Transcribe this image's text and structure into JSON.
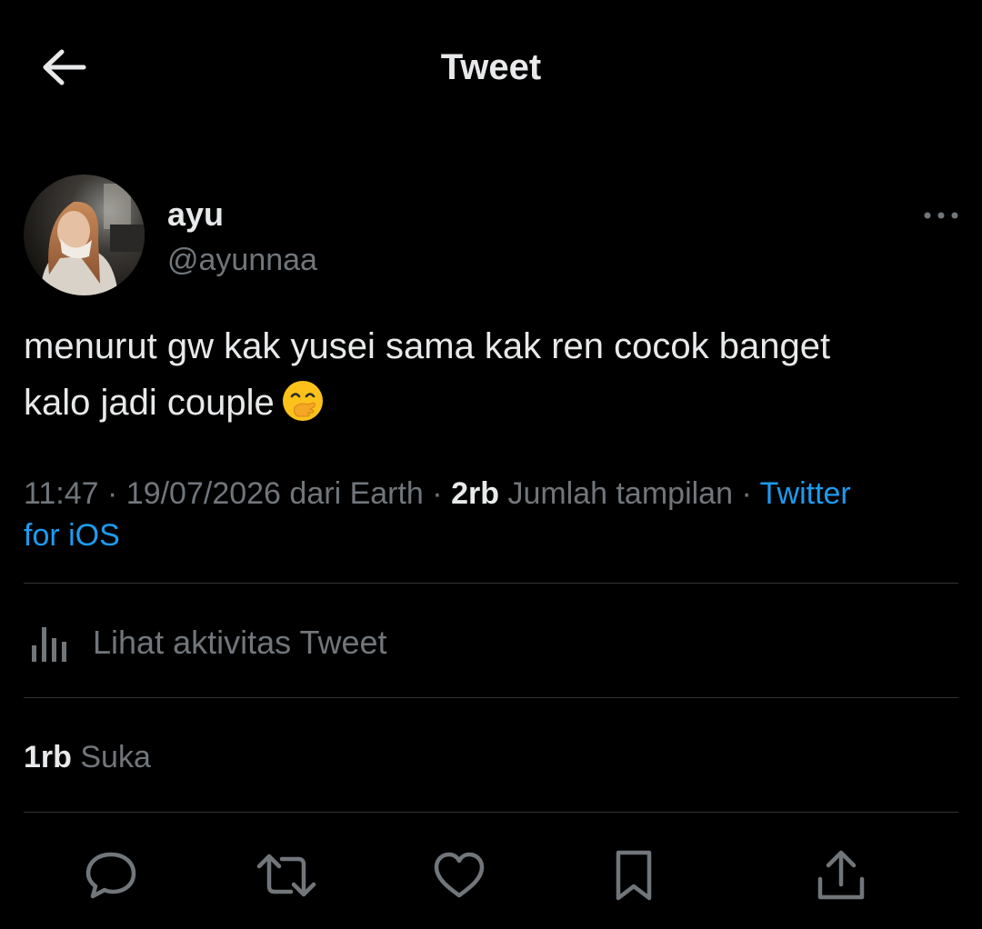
{
  "header": {
    "title": "Tweet",
    "back_icon": "arrow-left-icon"
  },
  "author": {
    "display_name": "ayu",
    "handle": "@ayunnaa",
    "more_icon": "more-horizontal-icon"
  },
  "tweet": {
    "text_line1": "menurut gw kak yusei sama kak ren cocok banget",
    "text_line2": "kalo jadi couple",
    "emoji_icon": "hand-over-mouth-emoji-icon"
  },
  "meta": {
    "time": "11:47",
    "separator": "·",
    "date": "19/07/2026",
    "location": "dari Earth",
    "views_count": "2rb",
    "views_label": "Jumlah tampilan",
    "client_part1": "Twitter",
    "client_part2": "for iOS"
  },
  "activity": {
    "label": "Lihat aktivitas Tweet",
    "icon": "analytics-bars-icon"
  },
  "likes": {
    "count": "1rb",
    "label": "Suka"
  },
  "actions": [
    {
      "name": "reply",
      "icon": "reply-bubble-icon"
    },
    {
      "name": "retweet",
      "icon": "retweet-icon"
    },
    {
      "name": "like",
      "icon": "heart-icon"
    },
    {
      "name": "bookmark",
      "icon": "bookmark-icon"
    },
    {
      "name": "share",
      "icon": "share-upload-icon"
    }
  ],
  "colors": {
    "background": "#000000",
    "primary_text": "#e7e9ea",
    "secondary_text": "#71767b",
    "accent": "#1d9bf0",
    "divider": "#2f3336"
  }
}
